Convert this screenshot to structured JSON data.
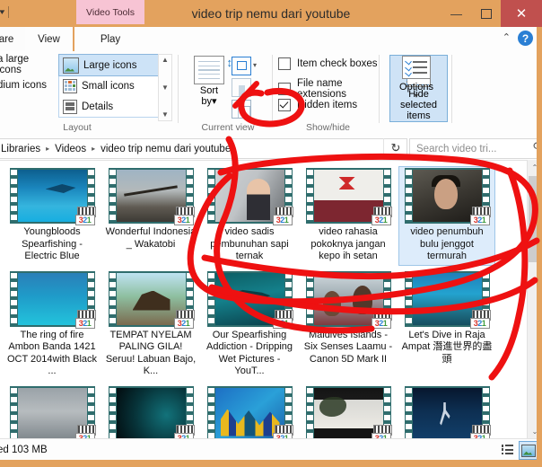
{
  "window": {
    "title": "video trip nemu dari youtube",
    "contextual_tab_group": "Video Tools",
    "buttons": {
      "minimize": "—",
      "maximize": "□",
      "close": "✕"
    }
  },
  "tabs": [
    {
      "label": "are",
      "name": "tab-share-clipped",
      "active": false
    },
    {
      "label": "View",
      "name": "tab-view",
      "active": true
    },
    {
      "label": "Play",
      "name": "tab-play",
      "active": false
    }
  ],
  "ribbon": {
    "collapse_caret": "⌃",
    "help_label": "?",
    "groups": {
      "layout": {
        "title": "Layout",
        "left_items": [
          {
            "label": "a large icons",
            "icon": "extra-large-icons-icon"
          },
          {
            "label": "dium icons",
            "icon": "medium-icons-icon"
          }
        ],
        "list_items": [
          {
            "label": "Large icons",
            "icon": "large-icons-icon",
            "selected": true
          },
          {
            "label": "Small icons",
            "icon": "small-icons-icon",
            "selected": false
          },
          {
            "label": "Details",
            "icon": "details-icon",
            "selected": false
          }
        ],
        "scroll": {
          "up": "▲",
          "down": "▼",
          "more": "▼"
        }
      },
      "current_view": {
        "title": "Current view",
        "sort_by_label": "Sort\nby",
        "sort_by_line1": "Sort",
        "sort_by_line2": "by",
        "sort_by_caret": "▾",
        "buttons": [
          {
            "name": "navigation-pane-icon",
            "caret": "▾",
            "enabled": true
          },
          {
            "name": "add-columns-icon",
            "caret": "▾",
            "enabled": false
          },
          {
            "name": "size-all-columns-icon",
            "caret": "",
            "enabled": true
          }
        ]
      },
      "show_hide": {
        "title": "Show/hide",
        "checkboxes": [
          {
            "label": "Item check boxes",
            "checked": false
          },
          {
            "label": "File name extensions",
            "checked": false
          },
          {
            "label": "Hidden items",
            "checked": true
          }
        ],
        "hide_selected": {
          "line1": "Hide selected",
          "line2": "items",
          "active": true
        }
      },
      "options": {
        "label": "Options",
        "caret": "▾"
      }
    }
  },
  "address_bar": {
    "breadcrumbs": [
      "Libraries",
      "Videos",
      "video trip nemu dari youtube"
    ],
    "separator": "▸",
    "dropdown_caret": "⌄",
    "refresh_icon": "↻",
    "search_placeholder": "Search video tri..."
  },
  "files": [
    {
      "name": "Youngbloods Spearfishing - Electric Blue",
      "art": "a1",
      "selected": false
    },
    {
      "name": "Wonderful Indonesia _ Wakatobi",
      "art": "a2",
      "selected": false
    },
    {
      "name": "video sadis pembunuhan sapi ternak",
      "art": "a3",
      "selected": false
    },
    {
      "name": "video rahasia pokoknya jangan kepo ih setan",
      "art": "a4",
      "selected": false
    },
    {
      "name": "video penumbuh bulu jenggot termurah",
      "art": "a5",
      "selected": true
    },
    {
      "name": "The ring of fire Ambon  Banda 1421 OCT 2014with Black ...",
      "art": "a6",
      "selected": false
    },
    {
      "name": "TEMPAT NYELAM PALING GILA! Seruu! Labuan Bajo, K...",
      "art": "a7",
      "selected": false
    },
    {
      "name": "Our Spearfishing Addiction - Dripping Wet Pictures - YouT...",
      "art": "a8",
      "selected": false
    },
    {
      "name": "Maldives Islands - Six Senses Laamu - Canon 5D Mark II",
      "art": "a9",
      "selected": false
    },
    {
      "name": "Let's Dive in Raja Ampat  潛進世界的盡頭",
      "art": "a10",
      "selected": false
    },
    {
      "name": "",
      "art": "a11",
      "selected": false
    },
    {
      "name": "",
      "art": "a12",
      "selected": false
    },
    {
      "name": "",
      "art": "a13",
      "selected": false
    },
    {
      "name": "",
      "art": "a14",
      "selected": false
    },
    {
      "name": "",
      "art": "a15",
      "selected": false
    }
  ],
  "thumbnail_badge": {
    "digits": [
      "3",
      "2",
      "1"
    ]
  },
  "status_bar": {
    "text": "ed  103 MB",
    "views": [
      {
        "name": "details-view-button",
        "active": false
      },
      {
        "name": "large-icons-view-button",
        "active": true
      }
    ]
  },
  "scrollbar": {
    "up": "⌃",
    "down": "⌄"
  },
  "annotations": {
    "color": "#ee1111",
    "marks": [
      "circle-around-hidden-items-checkbox",
      "large-ellipse-around-selected-video-row",
      "diagonal-stroke-across-file-grid"
    ]
  },
  "colors": {
    "title_bar": "#e3a25e",
    "contextual_tab": "#f7c4d4",
    "close_button": "#c0504e",
    "selection": "#cfe3f6",
    "annotation_red": "#ee1111"
  }
}
